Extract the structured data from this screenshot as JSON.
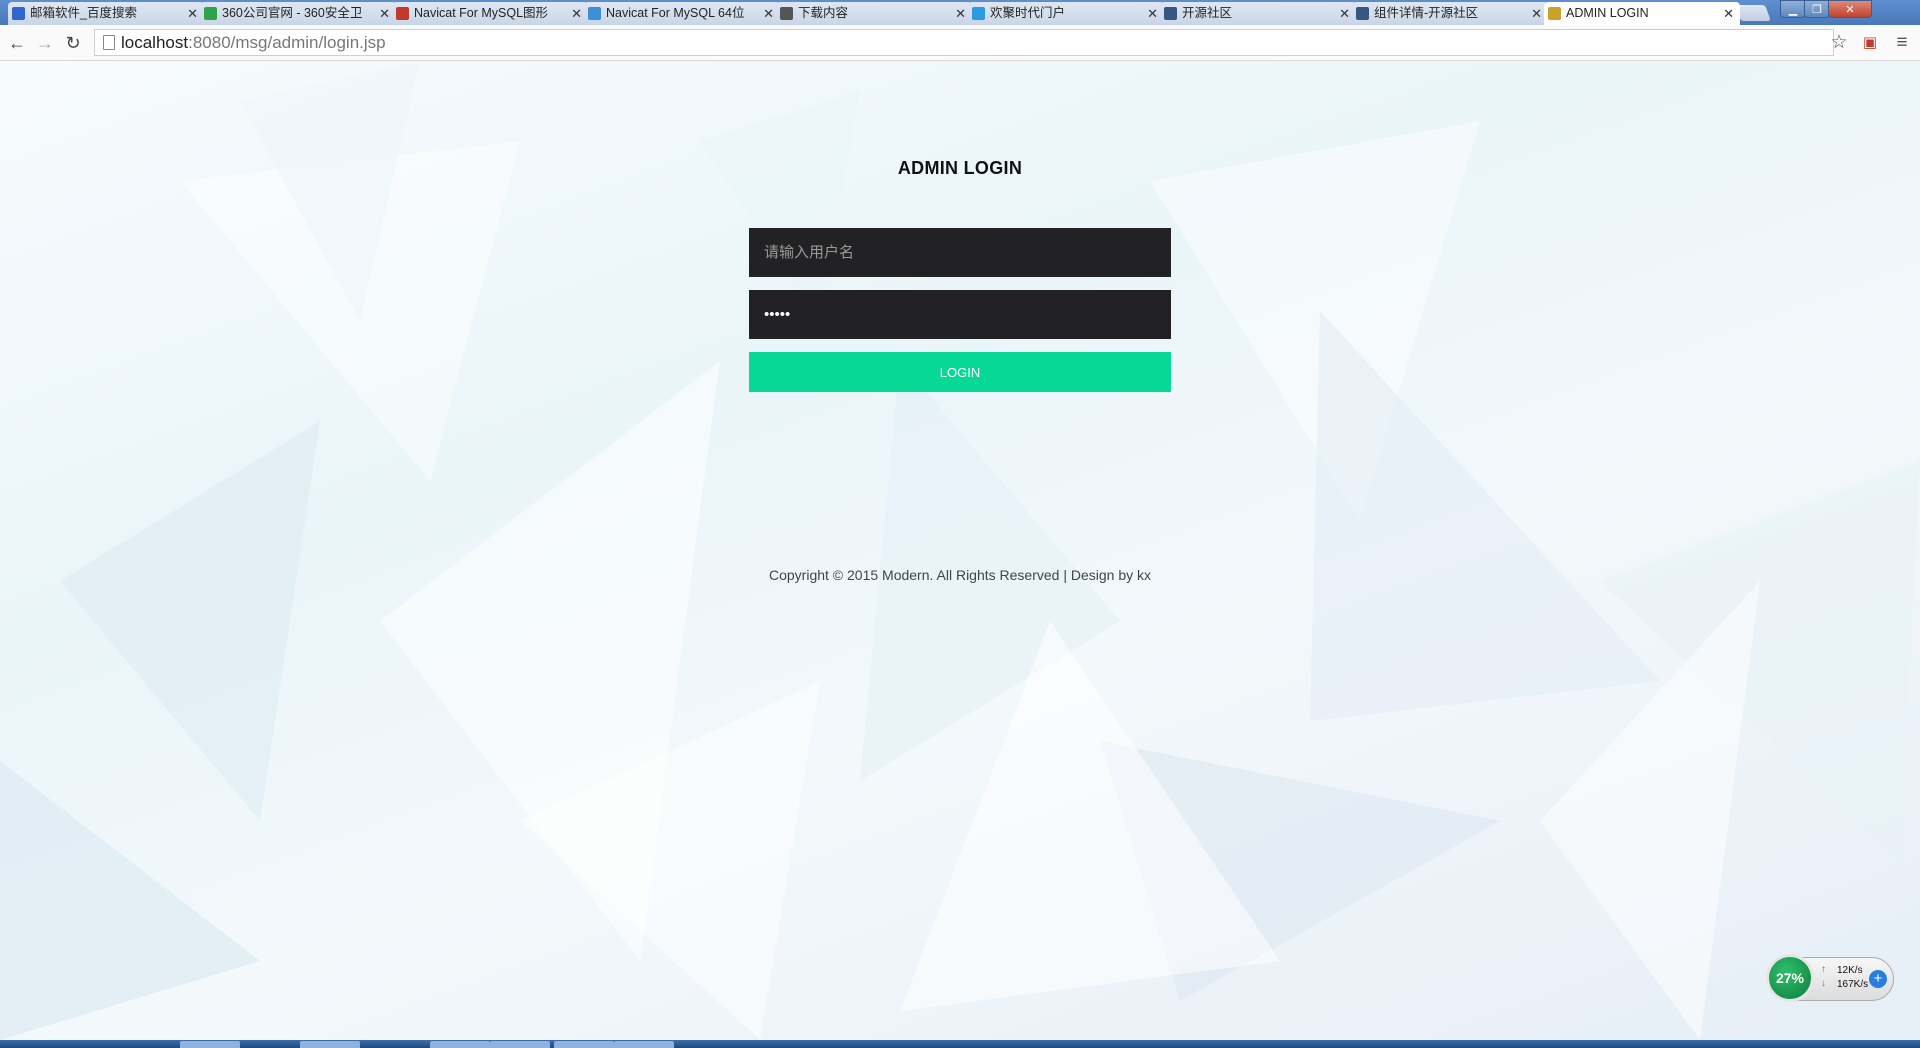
{
  "browser": {
    "tabs": [
      {
        "label": "邮箱软件_百度搜索",
        "favicon_color": "#3366cc"
      },
      {
        "label": "360公司官网 - 360安全卫",
        "favicon_color": "#2fa34a"
      },
      {
        "label": "Navicat For MySQL图形",
        "favicon_color": "#c0392b"
      },
      {
        "label": "Navicat For MySQL 64位",
        "favicon_color": "#3a8fd6"
      },
      {
        "label": "下载内容",
        "favicon_color": "#555555"
      },
      {
        "label": "欢聚时代门户",
        "favicon_color": "#2b9be0"
      },
      {
        "label": "开源社区",
        "favicon_color": "#33577d"
      },
      {
        "label": "组件详情-开源社区",
        "favicon_color": "#33577d"
      },
      {
        "label": "ADMIN LOGIN",
        "favicon_color": "#c9a227",
        "active": true
      }
    ],
    "url_host": "localhost",
    "url_rest": ":8080/msg/admin/login.jsp"
  },
  "login": {
    "title": "ADMIN LOGIN",
    "username_placeholder": "请输入用户名",
    "password_value": "•••••",
    "button_label": "LOGIN"
  },
  "footer": {
    "copyright": "Copyright © 2015 Modern. All Rights Reserved | Design by kx"
  },
  "net_widget": {
    "cpu": "27%",
    "upload": "12K/s",
    "download": "167K/s"
  },
  "colors": {
    "login_button": "#08d895",
    "input_bg": "#222224"
  }
}
